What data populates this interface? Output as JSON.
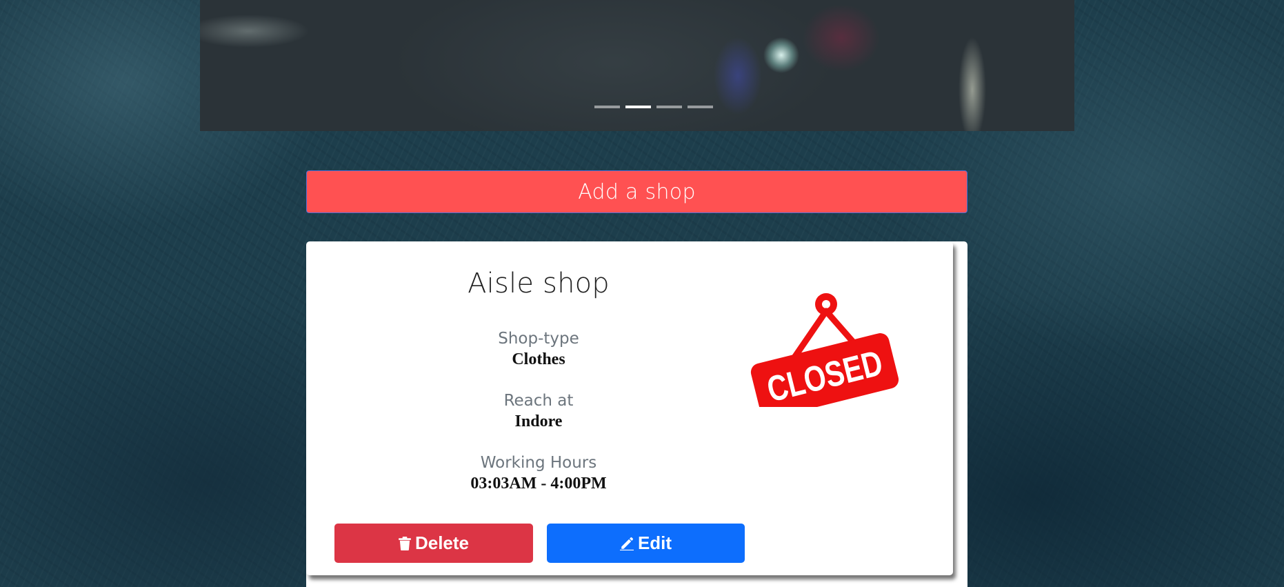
{
  "carousel": {
    "indicators": [
      {
        "active": false
      },
      {
        "active": true
      },
      {
        "active": false
      },
      {
        "active": false
      }
    ]
  },
  "add_shop": {
    "label": "Add a shop"
  },
  "shop": {
    "name": "Aisle shop",
    "fields": [
      {
        "label": "Shop-type",
        "value": "Clothes"
      },
      {
        "label": "Reach at",
        "value": "Indore"
      },
      {
        "label": "Working Hours",
        "value": "03:03AM - 4:00PM"
      }
    ],
    "status_sign": "CLOSED",
    "delete_label": "Delete",
    "edit_label": "Edit"
  },
  "colors": {
    "add_button": "#ff5152",
    "delete_button": "#dc3545",
    "edit_button": "#0d6efd",
    "closed_sign": "#ee1111"
  },
  "icons": {
    "delete": "trash-icon",
    "edit": "pencil-icon"
  }
}
